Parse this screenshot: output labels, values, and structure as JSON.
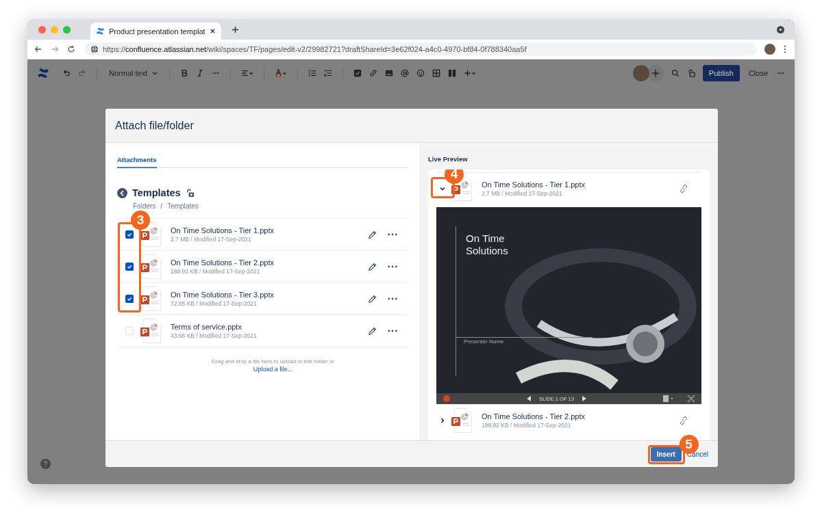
{
  "browser": {
    "tab_title": "Product presentation templat",
    "url": "https://**confluence.atlassian.net**/wiki/spaces/TF/pages/edit-v2/29982721?draftShareId=3e62f024-a4c0-4970-bf84-0f788340aa5f"
  },
  "toolbar": {
    "text_style": "Normal text",
    "publish": "Publish",
    "close": "Close"
  },
  "dialog": {
    "title": "Attach file/folder",
    "tabs": [
      {
        "label": "Attachments",
        "selected": true
      }
    ],
    "folder": {
      "name": "Templates",
      "breadcrumb": [
        "Folders",
        "Templates"
      ],
      "separator": "/"
    },
    "files": [
      {
        "name": "On Time Solutions - Tier 1.pptx",
        "meta": "2.7 MB / Modified 17-Sep-2021",
        "checked": true
      },
      {
        "name": "On Time Solutions - Tier 2.pptx",
        "meta": "188.92 KB / Modified 17-Sep-2021",
        "checked": true
      },
      {
        "name": "On Time Solutions - Tier 3.pptx",
        "meta": "72.95 KB / Modified 17-Sep-2021",
        "checked": true
      },
      {
        "name": "Terms of service.pptx",
        "meta": "43.66 KB / Modified 17-Sep-2021",
        "checked": false
      }
    ],
    "drop_hint": "Drag and drop a file here to upload to this folder or",
    "upload_link": "Upload a file...",
    "preview": {
      "heading": "Live Preview",
      "items": [
        {
          "name": "On Time Solutions - Tier 1.pptx",
          "meta": "2.7 MB / Modified 17-Sep-2021",
          "expanded": true
        },
        {
          "name": "On Time Solutions - Tier 2.pptx",
          "meta": "188.92 KB / Modified 17-Sep-2021",
          "expanded": false
        }
      ],
      "slide": {
        "title": "On Time Solutions",
        "subtitle": "Presenter Name",
        "counter": "SLIDE 1 OF 13"
      }
    },
    "insert": "Insert",
    "cancel": "Cancel"
  },
  "annotations": [
    {
      "label": "3",
      "kind": "checkboxes"
    },
    {
      "label": "4",
      "kind": "toggle"
    },
    {
      "label": "5",
      "kind": "insert"
    }
  ]
}
